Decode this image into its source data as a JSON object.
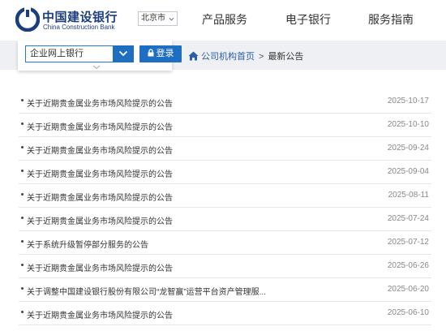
{
  "header": {
    "logo_cn": "中国建设银行",
    "logo_en": "China Construction Bank",
    "city": "北京市",
    "nav": [
      "产品服务",
      "电子银行",
      "服务指南"
    ]
  },
  "login": {
    "bank_option": "企业网上银行",
    "login_label": "登录"
  },
  "breadcrumb": {
    "home": "公司机构首页",
    "separator": ">",
    "current": "最新公告"
  },
  "notices": [
    {
      "title": "关于近期贵金属业务市场风险提示的公告",
      "date": "2025-10-17"
    },
    {
      "title": "关于近期贵金属业务市场风险提示的公告",
      "date": "2025-10-10"
    },
    {
      "title": "关于近期贵金属业务市场风险提示的公告",
      "date": "2025-09-24"
    },
    {
      "title": "关于近期贵金属业务市场风险提示的公告",
      "date": "2025-09-04"
    },
    {
      "title": "关于近期贵金属业务市场风险提示的公告",
      "date": "2025-08-11"
    },
    {
      "title": "关于近期贵金属业务市场风险提示的公告",
      "date": "2025-07-24"
    },
    {
      "title": "关于系统升级暂停部分服务的公告",
      "date": "2025-07-12"
    },
    {
      "title": "关于近期贵金属业务市场风险提示的公告",
      "date": "2025-06-26"
    },
    {
      "title": "关于调整中国建设银行股份有限公司“龙智赢”运营平台资产管理服...",
      "date": "2025-06-20"
    },
    {
      "title": "关于近期贵金属业务市场风险提示的公告",
      "date": "2025-06-10"
    }
  ],
  "colors": {
    "brand_blue": "#1d3e7c",
    "button_blue": "#1e6ec2",
    "band_gray": "#eef0f3"
  },
  "icons": [
    "ccb-logo-icon",
    "chevron-down-icon",
    "lock-icon",
    "home-icon"
  ]
}
